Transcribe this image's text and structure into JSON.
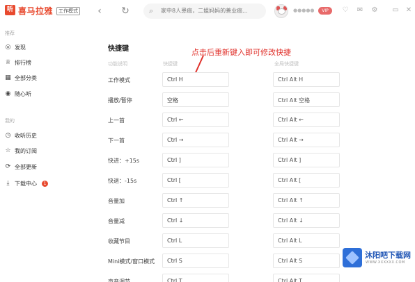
{
  "app": {
    "logo_glyph": "听",
    "name": "喜马拉雅",
    "mode_badge": "工作模式"
  },
  "topbar": {
    "search_placeholder": "家中8人患癌，二姐妈妈的善业癌..."
  },
  "sidebar": {
    "section1": "推荐",
    "items1": [
      {
        "icon": "discover-icon",
        "glyph": "◎",
        "label": "发现"
      },
      {
        "icon": "ranking-icon",
        "glyph": "♕",
        "label": "排行榜"
      },
      {
        "icon": "category-icon",
        "glyph": "▦",
        "label": "全部分类"
      },
      {
        "icon": "random-listen-icon",
        "glyph": "◉",
        "label": "随心听"
      }
    ],
    "section2": "我的",
    "items2": [
      {
        "icon": "history-icon",
        "glyph": "◷",
        "label": "收听历史"
      },
      {
        "icon": "subscribe-icon",
        "glyph": "☆",
        "label": "我的订阅"
      },
      {
        "icon": "update-icon",
        "glyph": "⟳",
        "label": "全部更新"
      },
      {
        "icon": "download-icon",
        "glyph": "⤓",
        "label": "下载中心",
        "badge": "1"
      }
    ]
  },
  "main": {
    "title": "快捷键",
    "hint": "点击后重新键入即可修改快捷",
    "col_function": "功能说明",
    "col_local": "快捷键",
    "col_global": "全局快捷键",
    "rows": [
      {
        "label": "工作模式",
        "local": "Ctrl H",
        "global": "Ctrl Alt H"
      },
      {
        "label": "播放/暂停",
        "local": "空格",
        "global": "Ctrl Alt 空格"
      },
      {
        "label": "上一首",
        "local": "Ctrl ←",
        "global": "Ctrl Alt ←"
      },
      {
        "label": "下一首",
        "local": "Ctrl →",
        "global": "Ctrl Alt →"
      },
      {
        "label": "快进：+15s",
        "local": "Ctrl ]",
        "global": "Ctrl Alt ]"
      },
      {
        "label": "快退：-15s",
        "local": "Ctrl [",
        "global": "Ctrl Alt ["
      },
      {
        "label": "音量加",
        "local": "Ctrl ↑",
        "global": "Ctrl Alt ↑"
      },
      {
        "label": "音量减",
        "local": "Ctrl ↓",
        "global": "Ctrl Alt ↓"
      },
      {
        "label": "收藏节目",
        "local": "Ctrl L",
        "global": "Ctrl Alt L"
      },
      {
        "label": "Mini模式/窗口模式",
        "local": "Ctrl S",
        "global": "Ctrl Alt S"
      },
      {
        "label": "声音调节",
        "local": "Ctrl T",
        "global": "Ctrl Alt T"
      }
    ]
  },
  "watermark": {
    "title": "沐阳吧下载网",
    "url": "WWW.XXXXXX.COM"
  },
  "colors": {
    "brand": "#e84a2f",
    "hint": "#e0312b"
  }
}
